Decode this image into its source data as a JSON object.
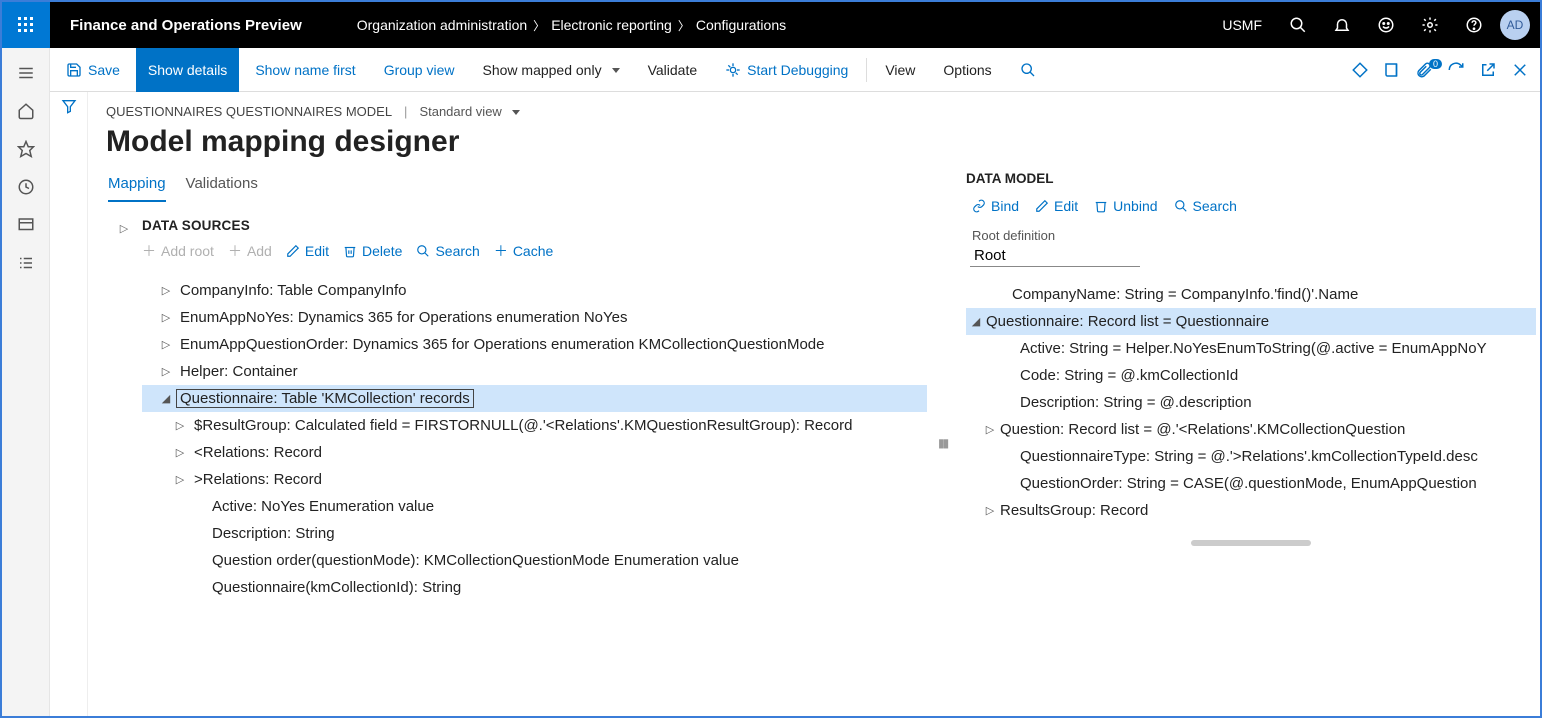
{
  "header": {
    "app_title": "Finance and Operations Preview",
    "breadcrumb": [
      "Organization administration",
      "Electronic reporting",
      "Configurations"
    ],
    "legal_entity": "USMF",
    "avatar": "AD"
  },
  "commands": {
    "save": "Save",
    "show_details": "Show details",
    "show_name_first": "Show name first",
    "group_view": "Group view",
    "show_mapped_only": "Show mapped only",
    "validate": "Validate",
    "start_debugging": "Start Debugging",
    "view": "View",
    "options": "Options",
    "attach_badge": "0"
  },
  "page": {
    "context_path": "QUESTIONNAIRES QUESTIONNAIRES MODEL",
    "view_selector": "Standard view",
    "title": "Model mapping designer"
  },
  "tabs": {
    "mapping": "Mapping",
    "validations": "Validations"
  },
  "data_sources": {
    "title": "DATA SOURCES",
    "toolbar": {
      "add_root": "Add root",
      "add": "Add",
      "edit": "Edit",
      "delete": "Delete",
      "search": "Search",
      "cache": "Cache"
    },
    "tree": [
      {
        "level": 0,
        "exp": "▷",
        "text": "CompanyInfo: Table CompanyInfo"
      },
      {
        "level": 0,
        "exp": "▷",
        "text": "EnumAppNoYes: Dynamics 365 for Operations enumeration NoYes"
      },
      {
        "level": 0,
        "exp": "▷",
        "text": "EnumAppQuestionOrder: Dynamics 365 for Operations enumeration KMCollectionQuestionMode"
      },
      {
        "level": 0,
        "exp": "▷",
        "text": "Helper: Container"
      },
      {
        "level": 0,
        "exp": "◢",
        "text": "Questionnaire: Table 'KMCollection' records",
        "selected": true
      },
      {
        "level": 1,
        "exp": "▷",
        "text": "$ResultGroup: Calculated field = FIRSTORNULL(@.'<Relations'.KMQuestionResultGroup): Record"
      },
      {
        "level": 1,
        "exp": "▷",
        "text": "<Relations: Record"
      },
      {
        "level": 1,
        "exp": "▷",
        "text": ">Relations: Record"
      },
      {
        "level": 1,
        "exp": "",
        "text": "Active: NoYes Enumeration value"
      },
      {
        "level": 1,
        "exp": "",
        "text": "Description: String"
      },
      {
        "level": 1,
        "exp": "",
        "text": "Question order(questionMode): KMCollectionQuestionMode Enumeration value"
      },
      {
        "level": 1,
        "exp": "",
        "text": "Questionnaire(kmCollectionId): String"
      }
    ]
  },
  "data_model": {
    "title": "DATA MODEL",
    "toolbar": {
      "bind": "Bind",
      "edit": "Edit",
      "unbind": "Unbind",
      "search": "Search"
    },
    "root_label": "Root definition",
    "root_value": "Root",
    "tree": [
      {
        "indent": "pad0",
        "exp": "",
        "text": "CompanyName: String = CompanyInfo.'find()'.Name"
      },
      {
        "indent": "pad0e",
        "exp": "◢",
        "text": "Questionnaire: Record list = Questionnaire",
        "selected": true
      },
      {
        "indent": "pad1",
        "exp": "",
        "text": "Active: String = Helper.NoYesEnumToString(@.active = EnumAppNoY"
      },
      {
        "indent": "pad1",
        "exp": "",
        "text": "Code: String = @.kmCollectionId"
      },
      {
        "indent": "pad1",
        "exp": "",
        "text": "Description: String = @.description"
      },
      {
        "indent": "pad1e",
        "exp": "▷",
        "text": "Question: Record list = @.'<Relations'.KMCollectionQuestion"
      },
      {
        "indent": "pad1",
        "exp": "",
        "text": "QuestionnaireType: String = @.'>Relations'.kmCollectionTypeId.desc"
      },
      {
        "indent": "pad1",
        "exp": "",
        "text": "QuestionOrder: String = CASE(@.questionMode, EnumAppQuestion"
      },
      {
        "indent": "pad1e",
        "exp": "▷",
        "text": "ResultsGroup: Record"
      }
    ]
  }
}
